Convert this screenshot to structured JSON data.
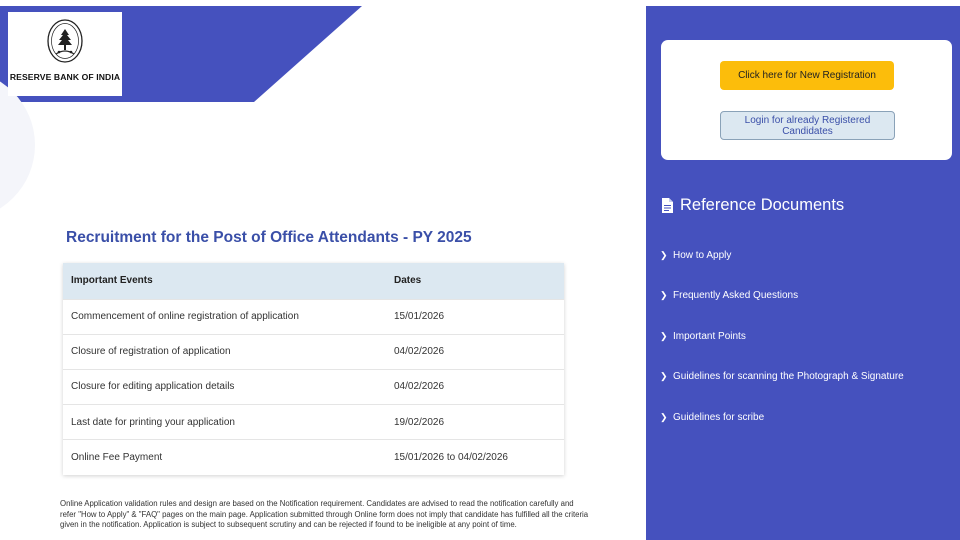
{
  "header": {
    "logo_text": "RESERVE BANK OF INDIA"
  },
  "main": {
    "title": "Recruitment for the Post of Office Attendants - PY 2025",
    "table": {
      "headers": [
        "Important Events",
        "Dates"
      ],
      "rows": [
        [
          "Commencement of online registration of application",
          "15/01/2026"
        ],
        [
          "Closure of registration of application",
          "04/02/2026"
        ],
        [
          "Closure for editing application details",
          "04/02/2026"
        ],
        [
          "Last date for printing your application",
          "19/02/2026"
        ],
        [
          "Online Fee Payment",
          "15/01/2026 to 04/02/2026"
        ]
      ]
    },
    "note": "Online Application validation rules and design are based on the Notification requirement. Candidates are advised to read the notification carefully and refer \"How to Apply\" & \"FAQ\" pages on the main page. Application submitted through Online form does not imply that candidate has fulfilled all the criteria given in the notification. Application is subject to subsequent scrutiny and can be rejected if found to be ineligible at any point of time."
  },
  "sidebar": {
    "register_label": "Click here for New Registration",
    "login_label": "Login for already Registered Candidates",
    "ref_title": "Reference Documents",
    "ref_items": [
      "How to Apply",
      "Frequently Asked Questions",
      "Important Points",
      "Guidelines for scanning the Photograph & Signature",
      "Guidelines for scribe"
    ]
  },
  "colors": {
    "brand_blue": "#4551be",
    "accent_yellow": "#fcbd0b",
    "table_header": "#dce8f1",
    "title_blue": "#3a4fa8"
  },
  "icons": {
    "emblem": "rbi-emblem-icon",
    "document": "document-icon",
    "chevron": "chevron-right-icon"
  }
}
